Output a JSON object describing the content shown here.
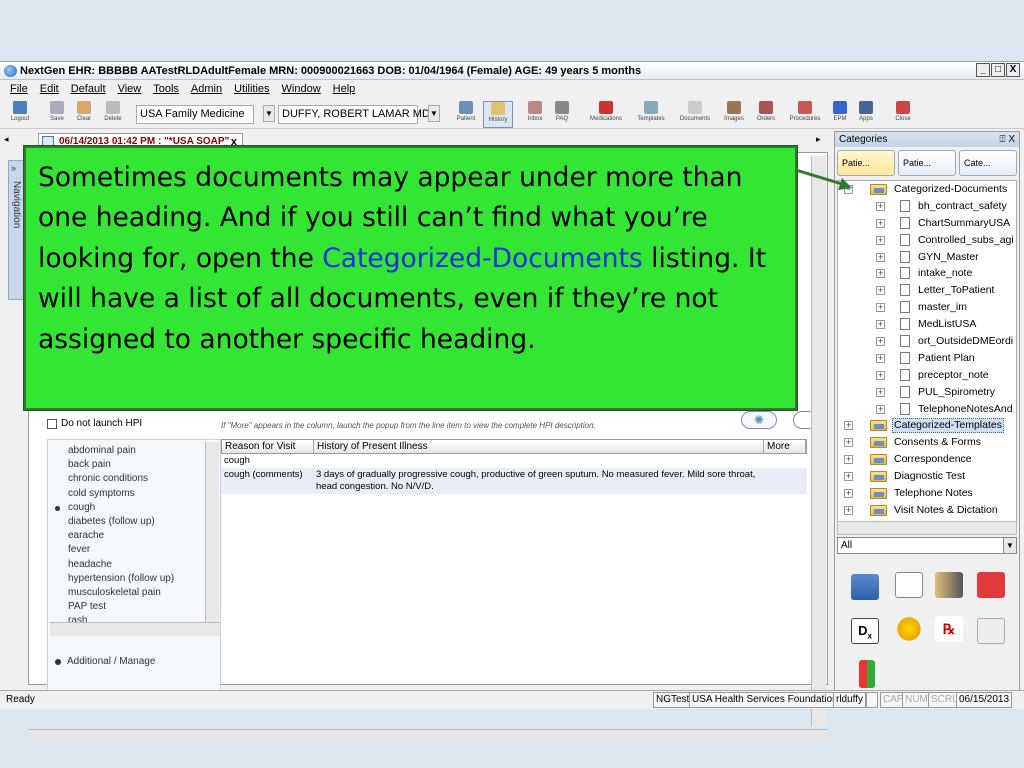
{
  "window": {
    "title": "NextGen EHR: BBBBB AATestRLDAdultFemale  MRN: 000900021663  DOB: 01/04/1964  (Female)  AGE: 49 years 5 months",
    "controls": [
      "_",
      "□",
      "X"
    ]
  },
  "menu": [
    "File",
    "Edit",
    "Default",
    "View",
    "Tools",
    "Admin",
    "Utilities",
    "Window",
    "Help"
  ],
  "toolbar": {
    "left_buttons": [
      "Logout",
      "Save",
      "Clear",
      "Delete"
    ],
    "practice": "USA Family Medicine",
    "provider": "DUFFY, ROBERT  LAMAR MD",
    "right_buttons": [
      "Patient",
      "History",
      "Inbox",
      "PAQ",
      "Medications",
      "Templates",
      "Documents",
      "Images",
      "Orders",
      "Procedures",
      "EPM",
      "Apps",
      "Close"
    ]
  },
  "document_tab": {
    "label": "06/14/2013 01:42 PM : \"*USA SOAP\"",
    "close": "x"
  },
  "navigation_label": "Navigation",
  "hpi": {
    "do_not_launch_label": "Do not launch HPI",
    "note": "If \"More\" appears in the column, launch the popup from the line item to view the complete HPI description.",
    "reasons": [
      "abdominal pain",
      "back pain",
      "chronic conditions",
      "cold symptoms",
      "cough",
      "diabetes (follow up)",
      "earache",
      "fever",
      "headache",
      "hypertension (follow up)",
      "musculoskeletal pain",
      "PAP test",
      "rash"
    ],
    "selected_reason": "cough",
    "additional_manage": "Additional / Manage",
    "table_headers": [
      "Reason for Visit",
      "History of Present Illness",
      "More"
    ],
    "rows": [
      {
        "reason": "cough",
        "history": ""
      },
      {
        "reason": "cough (comments)",
        "history": "3 days of gradually progressive cough, productive of green sputum.  No measured fever.  Mild sore throat, head congestion.  No N/V/D."
      }
    ]
  },
  "categories": {
    "header": "Categories",
    "header_controls": "⍐ X",
    "tabs": [
      "Patie...",
      "Patie...",
      "Cate..."
    ],
    "tree": [
      {
        "label": "Categorized-Documents",
        "type": "folder",
        "level": 0
      },
      {
        "label": "bh_contract_safety",
        "type": "doc",
        "level": 1
      },
      {
        "label": "ChartSummaryUSA",
        "type": "doc",
        "level": 1
      },
      {
        "label": "Controlled_subs_agi",
        "type": "doc",
        "level": 1
      },
      {
        "label": "GYN_Master",
        "type": "doc",
        "level": 1
      },
      {
        "label": "intake_note",
        "type": "doc",
        "level": 1
      },
      {
        "label": "Letter_ToPatient",
        "type": "doc",
        "level": 1
      },
      {
        "label": "master_im",
        "type": "doc",
        "level": 1
      },
      {
        "label": "MedListUSA",
        "type": "doc",
        "level": 1
      },
      {
        "label": "ort_OutsideDMEordi",
        "type": "doc",
        "level": 1
      },
      {
        "label": "Patient Plan",
        "type": "doc",
        "level": 1
      },
      {
        "label": "preceptor_note",
        "type": "doc",
        "level": 1
      },
      {
        "label": "PUL_Spirometry",
        "type": "doc",
        "level": 1
      },
      {
        "label": "TelephoneNotesAnd",
        "type": "doc",
        "level": 1
      },
      {
        "label": "Categorized-Templates",
        "type": "folder",
        "level": 0,
        "selected": true
      },
      {
        "label": "Consents & Forms",
        "type": "folder",
        "level": 0
      },
      {
        "label": "Correspondence",
        "type": "folder",
        "level": 0
      },
      {
        "label": "Diagnostic Test",
        "type": "folder",
        "level": 0
      },
      {
        "label": "Telephone Notes",
        "type": "folder",
        "level": 0
      },
      {
        "label": "Visit Notes & Dictation",
        "type": "folder",
        "level": 0
      }
    ],
    "filter": "All"
  },
  "status": {
    "left": "Ready",
    "cells": [
      "NGTest",
      "USA Health Services Foundation",
      "rlduffy",
      "",
      "CAP",
      "NUM",
      "SCRL",
      "06/15/2013"
    ]
  },
  "callout": {
    "text_before": "Sometimes documents may appear under more than one heading.  And if you still can’t find what you’re looking for, open the ",
    "highlight": "Categorized-Documents",
    "text_after": " listing.  It will have a list of all documents, even if they’re not assigned to another specific heading."
  },
  "colors": {
    "callout_bg": "#33e633",
    "callout_highlight": "#1a2fd8",
    "arrow": "#2f7a2f"
  }
}
